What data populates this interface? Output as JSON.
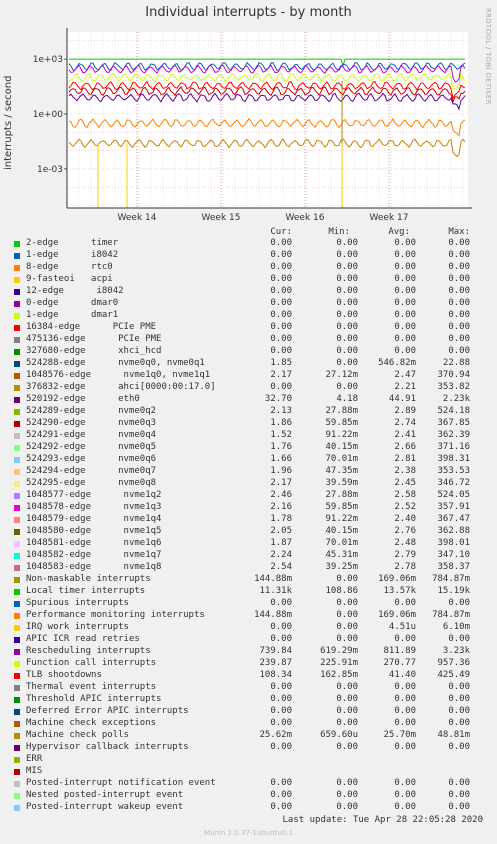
{
  "title": "Individual interrupts - by month",
  "side_label": "RRDTOOL / TOBI OETIKER",
  "chart_data": {
    "type": "line",
    "title": "Individual interrupts - by month",
    "ylabel": "interrupts / second",
    "yscale": "log",
    "y_ticks": [
      "1e+03",
      "1e+00",
      "1e-03"
    ],
    "x_ticks": [
      "Week 14",
      "Week 15",
      "Week 16",
      "Week 17"
    ],
    "series": [
      {
        "name": "2-edge timer",
        "color": "#00cc00",
        "level": 3
      },
      {
        "name": "Local timer interrupts",
        "color": "#0066b3",
        "level": 2.6
      },
      {
        "name": "Rescheduling interrupts",
        "color": "#cc00cc",
        "level": 2.45
      },
      {
        "name": "Function call interrupts",
        "color": "#ccff00",
        "level": 2.0
      },
      {
        "name": "TLB shootdowns",
        "color": "#ff0000",
        "level": 1.55
      },
      {
        "name": "nvme",
        "color": "#cc0000",
        "level": 1.25
      },
      {
        "name": "eth0",
        "color": "#660099",
        "level": 0.9
      },
      {
        "name": "nvme1",
        "color": "#ff8000",
        "level": -0.5
      },
      {
        "name": "Machine check polls",
        "color": "#cc8000",
        "level": -1.6
      }
    ]
  },
  "header": {
    "cur": "Cur:",
    "min": "Min:",
    "avg": "Avg:",
    "max": "Max:"
  },
  "legend": [
    {
      "label": "2-edge      timer",
      "color": "#00cc00",
      "cur": "0.00",
      "min": "0.00",
      "avg": "0.00",
      "max": "0.00"
    },
    {
      "label": "1-edge      i8042",
      "color": "#0066b3",
      "cur": "0.00",
      "min": "0.00",
      "avg": "0.00",
      "max": "0.00"
    },
    {
      "label": "8-edge      rtc0",
      "color": "#ff8000",
      "cur": "0.00",
      "min": "0.00",
      "avg": "0.00",
      "max": "0.00"
    },
    {
      "label": "9-fasteoi   acpi",
      "color": "#ffcc00",
      "cur": "0.00",
      "min": "0.00",
      "avg": "0.00",
      "max": "0.00"
    },
    {
      "label": "12-edge      i8042",
      "color": "#330099",
      "cur": "0.00",
      "min": "0.00",
      "avg": "0.00",
      "max": "0.00"
    },
    {
      "label": "0-edge      dmar0",
      "color": "#990099",
      "cur": "0.00",
      "min": "0.00",
      "avg": "0.00",
      "max": "0.00"
    },
    {
      "label": "1-edge      dmar1",
      "color": "#ccff00",
      "cur": "0.00",
      "min": "0.00",
      "avg": "0.00",
      "max": "0.00"
    },
    {
      "label": "16384-edge      PCIe PME",
      "color": "#ff0000",
      "cur": "0.00",
      "min": "0.00",
      "avg": "0.00",
      "max": "0.00"
    },
    {
      "label": "475136-edge      PCIe PME",
      "color": "#808080",
      "cur": "0.00",
      "min": "0.00",
      "avg": "0.00",
      "max": "0.00"
    },
    {
      "label": "327680-edge      xhci_hcd",
      "color": "#008f00",
      "cur": "0.00",
      "min": "0.00",
      "avg": "0.00",
      "max": "0.00"
    },
    {
      "label": "524288-edge      nvme0q0, nvme0q1",
      "color": "#00487d",
      "cur": "1.85",
      "min": "0.00",
      "avg": "546.82m",
      "max": "22.88"
    },
    {
      "label": "1048576-edge      nvme1q0, nvme1q1",
      "color": "#b35a00",
      "cur": "2.17",
      "min": "27.12m",
      "avg": "2.47",
      "max": "370.94"
    },
    {
      "label": "376832-edge      ahci[0000:00:17.0]",
      "color": "#b38f00",
      "cur": "0.00",
      "min": "0.00",
      "avg": "2.21",
      "max": "353.82"
    },
    {
      "label": "520192-edge      eth0",
      "color": "#6b006b",
      "cur": "32.70",
      "min": "4.18",
      "avg": "44.91",
      "max": "2.23k"
    },
    {
      "label": "524289-edge      nvme0q2",
      "color": "#8fb300",
      "cur": "2.13",
      "min": "27.88m",
      "avg": "2.89",
      "max": "524.18"
    },
    {
      "label": "524290-edge      nvme0q3",
      "color": "#b30000",
      "cur": "1.86",
      "min": "59.85m",
      "avg": "2.74",
      "max": "367.85"
    },
    {
      "label": "524291-edge      nvme0q4",
      "color": "#bebebe",
      "cur": "1.52",
      "min": "91.22m",
      "avg": "2.41",
      "max": "362.39"
    },
    {
      "label": "524292-edge      nvme0q5",
      "color": "#80ff80",
      "cur": "1.76",
      "min": "40.15m",
      "avg": "2.66",
      "max": "371.16"
    },
    {
      "label": "524293-edge      nvme0q6",
      "color": "#80c9ff",
      "cur": "1.66",
      "min": "70.01m",
      "avg": "2.81",
      "max": "398.31"
    },
    {
      "label": "524294-edge      nvme0q7",
      "color": "#ffc080",
      "cur": "1.96",
      "min": "47.35m",
      "avg": "2.38",
      "max": "353.53"
    },
    {
      "label": "524295-edge      nvme0q8",
      "color": "#ffe680",
      "cur": "2.17",
      "min": "39.59m",
      "avg": "2.45",
      "max": "346.72"
    },
    {
      "label": "1048577-edge      nvme1q2",
      "color": "#aa80ff",
      "cur": "2.46",
      "min": "27.88m",
      "avg": "2.58",
      "max": "524.05"
    },
    {
      "label": "1048578-edge      nvme1q3",
      "color": "#ee00cc",
      "cur": "2.16",
      "min": "59.85m",
      "avg": "2.52",
      "max": "357.91"
    },
    {
      "label": "1048579-edge      nvme1q4",
      "color": "#ff8080",
      "cur": "1.78",
      "min": "91.22m",
      "avg": "2.40",
      "max": "367.47"
    },
    {
      "label": "1048580-edge      nvme1q5",
      "color": "#666600",
      "cur": "2.05",
      "min": "40.15m",
      "avg": "2.76",
      "max": "362.88"
    },
    {
      "label": "1048581-edge      nvme1q6",
      "color": "#ffbfff",
      "cur": "1.87",
      "min": "70.01m",
      "avg": "2.48",
      "max": "398.01"
    },
    {
      "label": "1048582-edge      nvme1q7",
      "color": "#00ffcc",
      "cur": "2.24",
      "min": "45.31m",
      "avg": "2.79",
      "max": "347.10"
    },
    {
      "label": "1048583-edge      nvme1q8",
      "color": "#cc6699",
      "cur": "2.54",
      "min": "39.25m",
      "avg": "2.78",
      "max": "358.37"
    },
    {
      "label": "Non-maskable interrupts",
      "color": "#999900",
      "cur": "144.88m",
      "min": "0.00",
      "avg": "169.06m",
      "max": "784.87m"
    },
    {
      "label": "Local timer interrupts",
      "color": "#00cc00",
      "cur": "11.31k",
      "min": "108.86",
      "avg": "13.57k",
      "max": "15.19k"
    },
    {
      "label": "Spurious interrupts",
      "color": "#0066b3",
      "cur": "0.00",
      "min": "0.00",
      "avg": "0.00",
      "max": "0.00"
    },
    {
      "label": "Performance monitoring interrupts",
      "color": "#ff8000",
      "cur": "144.88m",
      "min": "0.00",
      "avg": "169.06m",
      "max": "784.87m"
    },
    {
      "label": "IRQ work interrupts",
      "color": "#ffcc00",
      "cur": "0.00",
      "min": "0.00",
      "avg": "4.51u",
      "max": "6.10m"
    },
    {
      "label": "APIC ICR read retries",
      "color": "#330099",
      "cur": "0.00",
      "min": "0.00",
      "avg": "0.00",
      "max": "0.00"
    },
    {
      "label": "Rescheduling interrupts",
      "color": "#990099",
      "cur": "739.84",
      "min": "619.29m",
      "avg": "811.89",
      "max": "3.23k"
    },
    {
      "label": "Function call interrupts",
      "color": "#ccff00",
      "cur": "239.87",
      "min": "225.91m",
      "avg": "270.77",
      "max": "957.36"
    },
    {
      "label": "TLB shootdowns",
      "color": "#ff0000",
      "cur": "108.34",
      "min": "162.85m",
      "avg": "41.40",
      "max": "425.49"
    },
    {
      "label": "Thermal event interrupts",
      "color": "#808080",
      "cur": "0.00",
      "min": "0.00",
      "avg": "0.00",
      "max": "0.00"
    },
    {
      "label": "Threshold APIC interrupts",
      "color": "#008f00",
      "cur": "0.00",
      "min": "0.00",
      "avg": "0.00",
      "max": "0.00"
    },
    {
      "label": "Deferred Error APIC interrupts",
      "color": "#00487d",
      "cur": "0.00",
      "min": "0.00",
      "avg": "0.00",
      "max": "0.00"
    },
    {
      "label": "Machine check exceptions",
      "color": "#b35a00",
      "cur": "0.00",
      "min": "0.00",
      "avg": "0.00",
      "max": "0.00"
    },
    {
      "label": "Machine check polls",
      "color": "#b38f00",
      "cur": "25.62m",
      "min": "659.60u",
      "avg": "25.70m",
      "max": "48.81m"
    },
    {
      "label": "Hypervisor callback interrupts",
      "color": "#6b006b",
      "cur": "0.00",
      "min": "0.00",
      "avg": "0.00",
      "max": "0.00"
    },
    {
      "label": "ERR",
      "color": "#8fb300",
      "cur": "",
      "min": "",
      "avg": "",
      "max": ""
    },
    {
      "label": "MIS",
      "color": "#b30000",
      "cur": "",
      "min": "",
      "avg": "",
      "max": ""
    },
    {
      "label": "Posted-interrupt notification event",
      "color": "#bebebe",
      "cur": "0.00",
      "min": "0.00",
      "avg": "0.00",
      "max": "0.00"
    },
    {
      "label": "Nested posted-interrupt event",
      "color": "#80ff80",
      "cur": "0.00",
      "min": "0.00",
      "avg": "0.00",
      "max": "0.00"
    },
    {
      "label": "Posted-interrupt wakeup event",
      "color": "#80c9ff",
      "cur": "0.00",
      "min": "0.00",
      "avg": "0.00",
      "max": "0.00"
    }
  ],
  "last_update": "Last update: Tue Apr 28 22:05:28 2020",
  "footer": "Munin 2.0.37-1ubuntu0.1"
}
